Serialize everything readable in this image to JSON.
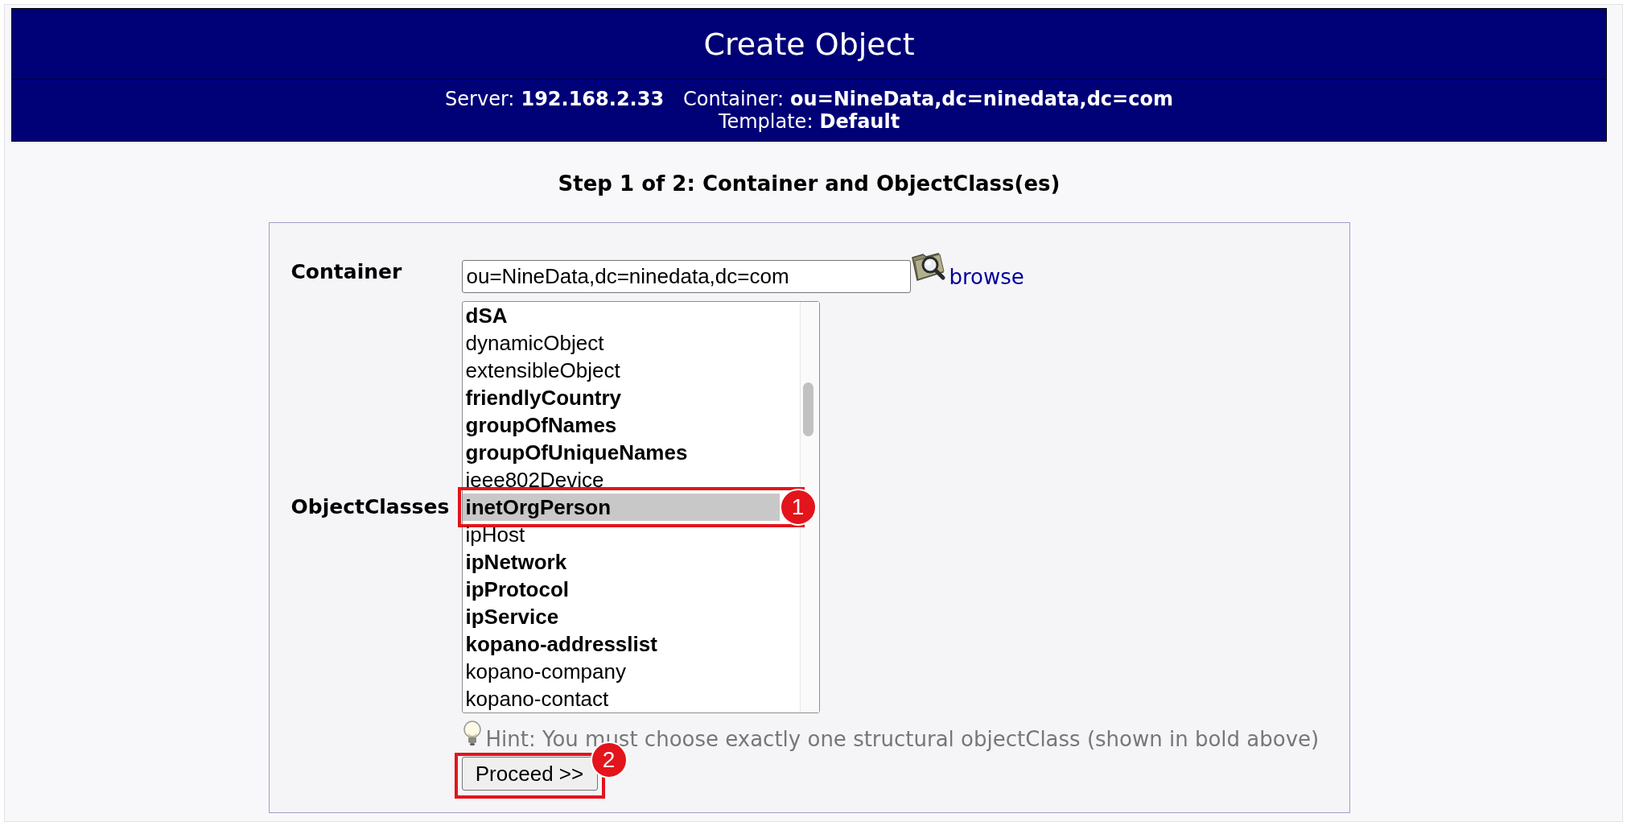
{
  "header": {
    "title": "Create Object",
    "info_lines": [
      [
        {
          "label": "Server:",
          "value": "192.168.2.33"
        },
        {
          "label": "Container:",
          "value": "ou=NineData,dc=ninedata,dc=com"
        }
      ],
      [
        {
          "label": "Template:",
          "value": "Default"
        }
      ]
    ]
  },
  "step_title": "Step 1 of 2: Container and ObjectClass(es)",
  "form": {
    "container": {
      "label": "Container",
      "value": "ou=NineData,dc=ninedata,dc=com",
      "browse_link": "browse"
    },
    "objectclasses": {
      "label": "ObjectClasses",
      "items": [
        {
          "name": "dSA",
          "structural": true,
          "selected": false
        },
        {
          "name": "dynamicObject",
          "structural": false,
          "selected": false
        },
        {
          "name": "extensibleObject",
          "structural": false,
          "selected": false
        },
        {
          "name": "friendlyCountry",
          "structural": true,
          "selected": false
        },
        {
          "name": "groupOfNames",
          "structural": true,
          "selected": false
        },
        {
          "name": "groupOfUniqueNames",
          "structural": true,
          "selected": false
        },
        {
          "name": "ieee802Device",
          "structural": false,
          "selected": false
        },
        {
          "name": "inetOrgPerson",
          "structural": true,
          "selected": true,
          "callout": "1"
        },
        {
          "name": "ipHost",
          "structural": false,
          "selected": false
        },
        {
          "name": "ipNetwork",
          "structural": true,
          "selected": false
        },
        {
          "name": "ipProtocol",
          "structural": true,
          "selected": false
        },
        {
          "name": "ipService",
          "structural": true,
          "selected": false
        },
        {
          "name": "kopano-addresslist",
          "structural": true,
          "selected": false
        },
        {
          "name": "kopano-company",
          "structural": false,
          "selected": false
        },
        {
          "name": "kopano-contact",
          "structural": false,
          "selected": false
        }
      ]
    },
    "hint": "Hint: You must choose exactly one structural objectClass (shown in bold above)",
    "proceed_button": {
      "label": "Proceed >>",
      "callout": "2"
    }
  }
}
